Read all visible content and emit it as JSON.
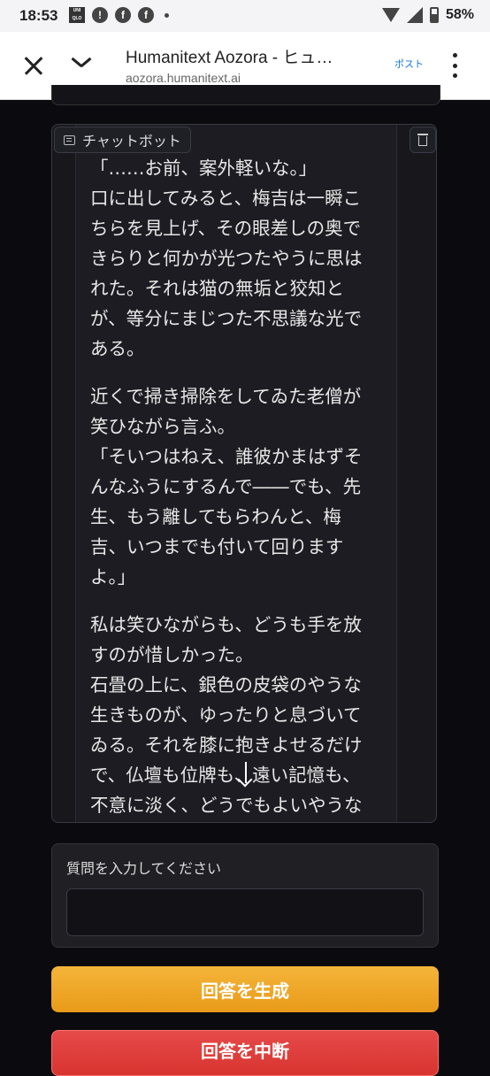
{
  "status_bar": {
    "time": "18:53",
    "battery": "58%"
  },
  "browser": {
    "title": "Humanitext Aozora - ヒュ…",
    "url": "aozora.humanitext.ai",
    "post_label": "ポスト"
  },
  "chat": {
    "label": "チャットボット",
    "paragraphs": [
      [
        "「……お前、案外軽いな。」",
        "口に出してみると、梅吉は一瞬こ",
        "ちらを見上げ、その眼差しの奥で",
        "きらりと何かが光つたやうに思は",
        "れた。それは猫の無垢と狡知と",
        "が、等分にまじつた不思議な光で",
        "ある。"
      ],
      [
        "近くで掃き掃除をしてゐた老僧が",
        "笑ひながら言ふ。",
        "「そいつはねえ、誰彼かまはずそ",
        "んなふうにするんで――でも、先",
        "生、もう離してもらわんと、梅",
        "吉、いつまでも付いて回ります",
        "よ。」"
      ],
      [
        "私は笑ひながらも、どうも手を放",
        "すのが惜しかった。",
        "石畳の上に、銀色の皮袋のやうな",
        "生きものが、ゆったりと息づいて",
        "ゐる。それを膝に抱きよせるだけ",
        "で、仏壇も位牌も、遠い記憶も、",
        "不意に淡く、どうでもよいやうな"
      ]
    ]
  },
  "question": {
    "label": "質問を入力してください",
    "value": ""
  },
  "buttons": {
    "generate": "回答を生成",
    "second": "回答を中断"
  }
}
